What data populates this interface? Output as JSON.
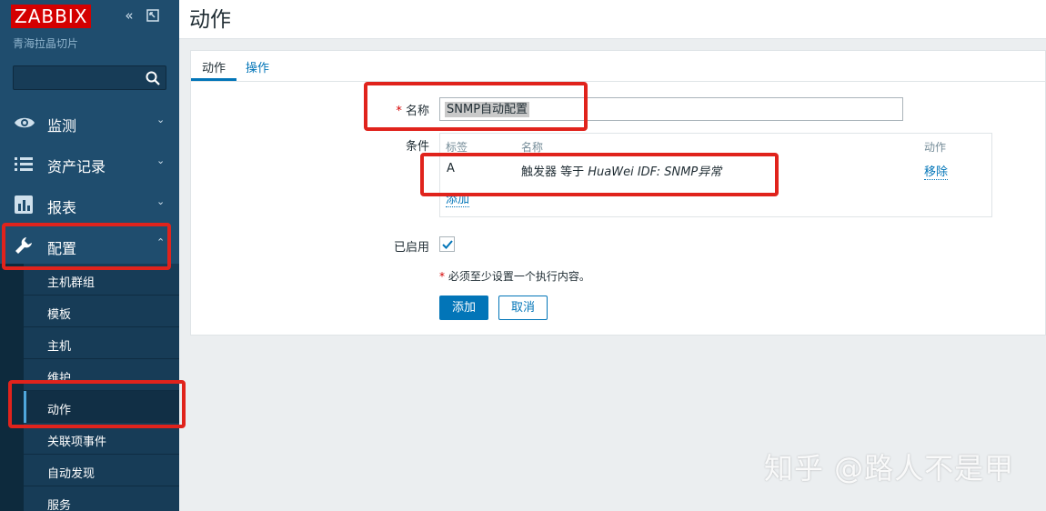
{
  "sidebar": {
    "logo": "ZABBIX",
    "subtitle": "青海拉晶切片",
    "search": {
      "value": "",
      "placeholder": ""
    },
    "menu": [
      {
        "label": "监测",
        "icon": "eye-icon",
        "expanded": false
      },
      {
        "label": "资产记录",
        "icon": "list-icon",
        "expanded": false
      },
      {
        "label": "报表",
        "icon": "chart-icon",
        "expanded": false
      },
      {
        "label": "配置",
        "icon": "wrench-icon",
        "expanded": true
      }
    ],
    "submenu": [
      {
        "label": "主机群组",
        "active": false
      },
      {
        "label": "模板",
        "active": false
      },
      {
        "label": "主机",
        "active": false
      },
      {
        "label": "维护",
        "active": false
      },
      {
        "label": "动作",
        "active": true
      },
      {
        "label": "关联项事件",
        "active": false
      },
      {
        "label": "自动发现",
        "active": false
      },
      {
        "label": "服务",
        "active": false
      }
    ]
  },
  "page": {
    "title": "动作"
  },
  "tabs": [
    {
      "label": "动作",
      "active": true
    },
    {
      "label": "操作",
      "active": false
    }
  ],
  "form": {
    "name_label": "名称",
    "name_value": "SNMP自动配置",
    "conditions_label": "条件",
    "conditions_table": {
      "headers": [
        "标签",
        "名称",
        "动作"
      ],
      "rows": [
        {
          "label": "A",
          "name_prefix": "触发器 等于 ",
          "name_italic": "HuaWei IDF: SNMP异常",
          "action": "移除"
        }
      ],
      "add_link": "添加"
    },
    "enabled_label": "已启用",
    "enabled": true,
    "note": "必须至少设置一个执行内容。",
    "add_button": "添加",
    "cancel_button": "取消"
  },
  "watermark": "知乎 @路人不是甲",
  "colors": {
    "accent": "#0275b8",
    "sidebar": "#1f4d6e",
    "highlight": "#e0231c",
    "logo": "#d40000"
  }
}
